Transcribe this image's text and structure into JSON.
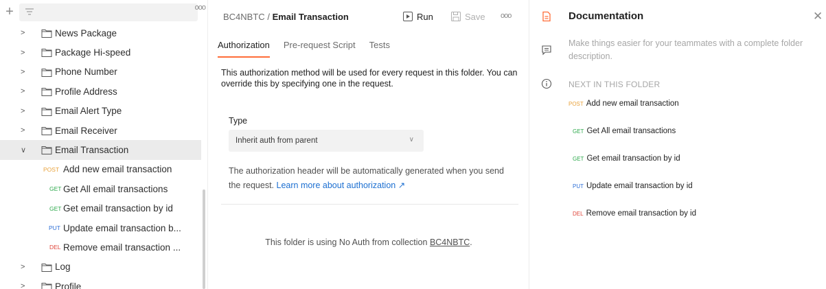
{
  "colors": {
    "post": "#e8a13a",
    "get": "#2ba84a",
    "put": "#2e6fd6",
    "del": "#e0453a",
    "accent": "#ff6c37",
    "link": "#1c6fd1",
    "doc_icon": "#ff6c37"
  },
  "sidebar": {
    "new_icon": "plus-icon",
    "filter_icon": "filter-icon",
    "more_label": "ooo",
    "folders_top": [
      {
        "label": "News Package",
        "chevron": ">"
      },
      {
        "label": "Package Hi-speed",
        "chevron": ">"
      },
      {
        "label": "Phone Number",
        "chevron": ">"
      },
      {
        "label": "Profile Address",
        "chevron": ">"
      },
      {
        "label": "Email Alert Type",
        "chevron": ">"
      },
      {
        "label": "Email Receiver",
        "chevron": ">"
      }
    ],
    "selected_folder": {
      "label": "Email Transaction",
      "chevron": "∨"
    },
    "requests": [
      {
        "method": "POST",
        "label": "Add new email transaction"
      },
      {
        "method": "GET",
        "label": "Get All email transactions"
      },
      {
        "method": "GET",
        "label": "Get email transaction by id"
      },
      {
        "method": "PUT",
        "label": "Update email transaction b..."
      },
      {
        "method": "DEL",
        "label": "Remove email transaction ..."
      }
    ],
    "folders_bottom": [
      {
        "label": "Log",
        "chevron": ">"
      },
      {
        "label": "Profile",
        "chevron": ">"
      }
    ]
  },
  "header": {
    "collection": "BC4NBTC",
    "separator": "/",
    "folder": "Email Transaction",
    "run_label": "Run",
    "save_label": "Save",
    "more_label": "ooo"
  },
  "tabs": [
    {
      "label": "Authorization",
      "active": true
    },
    {
      "label": "Pre-request Script",
      "active": false
    },
    {
      "label": "Tests",
      "active": false
    }
  ],
  "auth": {
    "description": "This authorization method will be used for every request in this folder. You can override this by specifying one in the request.",
    "type_label": "Type",
    "type_value": "Inherit auth from parent",
    "note_text": "The authorization header will be automatically generated when you send the request.",
    "note_link": "Learn more about authorization ↗",
    "no_auth_prefix": "This folder is using No Auth from collection",
    "no_auth_collection": "BC4NBTC",
    "no_auth_suffix": "."
  },
  "docs": {
    "title": "Documentation",
    "close": "✕",
    "description": "Make things easier for your teammates with a complete folder description.",
    "next_heading": "NEXT IN THIS FOLDER",
    "requests": [
      {
        "method": "POST",
        "label": "Add new email transaction"
      },
      {
        "method": "GET",
        "label": "Get All email transactions"
      },
      {
        "method": "GET",
        "label": "Get email transaction by id"
      },
      {
        "method": "PUT",
        "label": "Update email transaction by id"
      },
      {
        "method": "DEL",
        "label": "Remove email transaction by id"
      }
    ]
  }
}
